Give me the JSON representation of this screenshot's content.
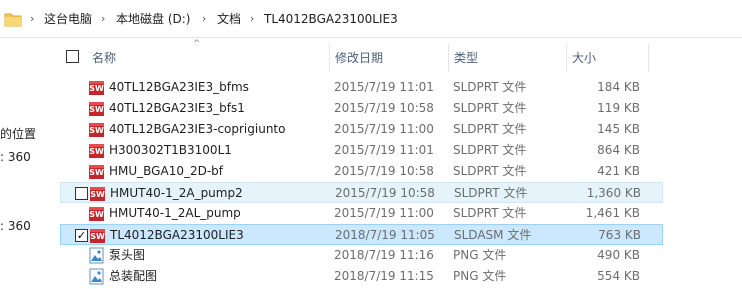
{
  "breadcrumb": {
    "items": [
      "这台电脑",
      "本地磁盘 (D:)",
      "文档",
      "TL4012BGA23100LIE3"
    ]
  },
  "left_pane": {
    "fragments": [
      "的位置",
      ": 360",
      ": 360"
    ]
  },
  "columns": {
    "name": "名称",
    "date": "修改日期",
    "type": "类型",
    "size": "大小"
  },
  "files": [
    {
      "name": "40TL12BGA23IE3_bfms",
      "date": "2015/7/19 11:01",
      "type": "SLDPRT 文件",
      "size": "184 KB",
      "icon": "solidworks-part-icon",
      "checked": false,
      "state": "normal"
    },
    {
      "name": "40TL12BGA23IE3_bfs1",
      "date": "2015/7/19 10:58",
      "type": "SLDPRT 文件",
      "size": "119 KB",
      "icon": "solidworks-part-icon",
      "checked": false,
      "state": "normal"
    },
    {
      "name": "40TL12BGA23IE3-coprigiunto",
      "date": "2015/7/19 11:00",
      "type": "SLDPRT 文件",
      "size": "145 KB",
      "icon": "solidworks-part-icon",
      "checked": false,
      "state": "normal"
    },
    {
      "name": "H300302T1B3100L1",
      "date": "2015/7/19 11:01",
      "type": "SLDPRT 文件",
      "size": "864 KB",
      "icon": "solidworks-part-icon",
      "checked": false,
      "state": "normal"
    },
    {
      "name": "HMU_BGA10_2D-bf",
      "date": "2015/7/19 10:58",
      "type": "SLDPRT 文件",
      "size": "421 KB",
      "icon": "solidworks-part-icon",
      "checked": false,
      "state": "normal"
    },
    {
      "name": "HMUT40-1_2A_pump2",
      "date": "2015/7/19 10:58",
      "type": "SLDPRT 文件",
      "size": "1,360 KB",
      "icon": "solidworks-part-icon",
      "checked": false,
      "state": "hover"
    },
    {
      "name": "HMUT40-1_2AL_pump",
      "date": "2015/7/19 11:00",
      "type": "SLDPRT 文件",
      "size": "1,461 KB",
      "icon": "solidworks-part-icon",
      "checked": false,
      "state": "normal"
    },
    {
      "name": "TL4012BGA23100LIE3",
      "date": "2018/7/19 11:05",
      "type": "SLDASM 文件",
      "size": "763 KB",
      "icon": "solidworks-assembly-icon",
      "checked": true,
      "state": "selected"
    },
    {
      "name": "泵头图",
      "date": "2018/7/19 11:16",
      "type": "PNG 文件",
      "size": "490 KB",
      "icon": "png-image-icon",
      "checked": false,
      "state": "normal"
    },
    {
      "name": "总装配图",
      "date": "2018/7/19 11:15",
      "type": "PNG 文件",
      "size": "554 KB",
      "icon": "png-image-icon",
      "checked": false,
      "state": "normal"
    }
  ],
  "check_mark": "✓",
  "colors": {
    "solidworks_red": "#c4262e",
    "selected_bg": "#cce8ff",
    "hover_bg": "#e5f3fb",
    "header_text": "#4c607a",
    "folder_yellow": "#f3c553"
  }
}
